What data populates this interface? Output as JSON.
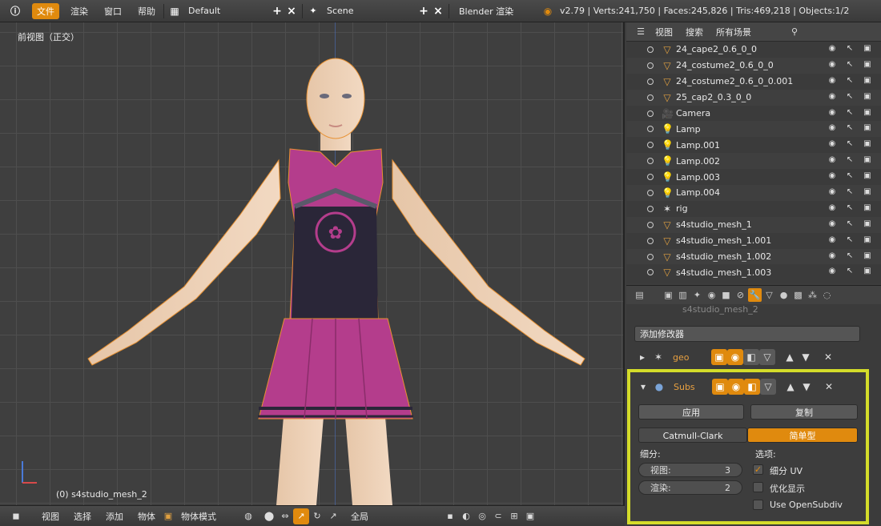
{
  "topbar": {
    "menu": [
      "文件",
      "渲染",
      "窗口",
      "帮助"
    ],
    "layout": "Default",
    "scene": "Scene",
    "engine": "Blender 渲染",
    "stats": "v2.79 | Verts:241,750 | Faces:245,826 | Tris:469,218 | Objects:1/2"
  },
  "viewport": {
    "title": "前视图（正交）",
    "active_object": "(0) s4studio_mesh_2"
  },
  "bottombar": {
    "items": [
      "视图",
      "选择",
      "添加",
      "物体"
    ],
    "mode": "物体模式",
    "pivot": "全局"
  },
  "outliner": {
    "header": [
      "视图",
      "搜索",
      "所有场景"
    ],
    "rows": [
      {
        "name": "24_cape2_0.6_0_0",
        "icon": "mesh"
      },
      {
        "name": "24_costume2_0.6_0_0",
        "icon": "mesh"
      },
      {
        "name": "24_costume2_0.6_0_0.001",
        "icon": "mesh"
      },
      {
        "name": "25_cap2_0.3_0_0",
        "icon": "mesh"
      },
      {
        "name": "Camera",
        "icon": "camera"
      },
      {
        "name": "Lamp",
        "icon": "lamp"
      },
      {
        "name": "Lamp.001",
        "icon": "lamp"
      },
      {
        "name": "Lamp.002",
        "icon": "lamp"
      },
      {
        "name": "Lamp.003",
        "icon": "lamp"
      },
      {
        "name": "Lamp.004",
        "icon": "lamp"
      },
      {
        "name": "rig",
        "icon": "armature"
      },
      {
        "name": "s4studio_mesh_1",
        "icon": "mesh"
      },
      {
        "name": "s4studio_mesh_1.001",
        "icon": "mesh"
      },
      {
        "name": "s4studio_mesh_1.002",
        "icon": "mesh"
      },
      {
        "name": "s4studio_mesh_1.003",
        "icon": "mesh"
      }
    ]
  },
  "properties": {
    "breadcrumb": "s4studio_mesh_2",
    "add_modifier": "添加修改器",
    "modifier1_name": "geo",
    "modifier2_name": "Subs",
    "apply": "应用",
    "copy": "复制",
    "catmull": "Catmull-Clark",
    "simple": "简单型",
    "subdivisions_label": "细分:",
    "options_label": "选项:",
    "view_label": "视图:",
    "view_value": "3",
    "render_label": "渲染:",
    "render_value": "2",
    "opt1": "细分 UV",
    "opt2": "优化显示",
    "opt3": "Use OpenSubdiv"
  },
  "colors": {
    "accent": "#e08a0e",
    "highlight": "#d4dc2a",
    "outfit": "#b43d8c"
  }
}
